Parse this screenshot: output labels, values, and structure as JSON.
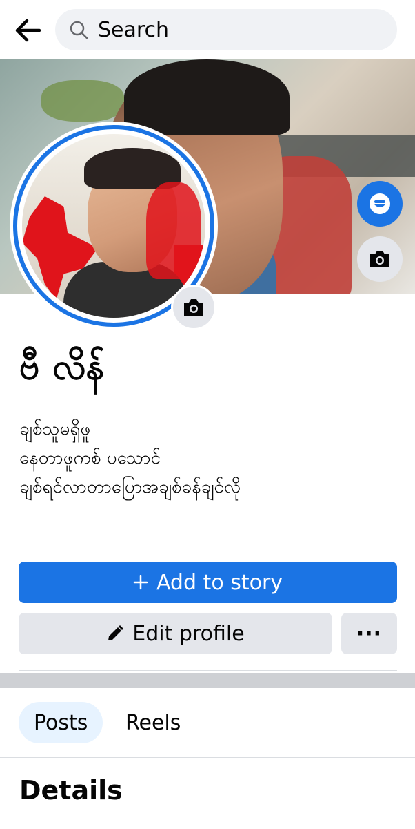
{
  "topbar": {
    "back_icon": "arrow-left-icon",
    "search_placeholder": "Search",
    "search_icon": "search-icon"
  },
  "cover": {
    "avatar_shortcut_icon": "messenger-avatar-icon",
    "camera_icon": "camera-icon"
  },
  "profile": {
    "name": "ဗီ လိန်",
    "bio_lines": [
      "ချစ်သူမရှိဖူ",
      "နေတာဖူကစ် ပသောင်",
      "ချစ်ရင်လာတာပြောအချစ်ခန်ချင်လို"
    ]
  },
  "actions": {
    "add_story_label": "Add to story",
    "edit_profile_label": "Edit profile",
    "more_label": "···"
  },
  "tabs": [
    {
      "label": "Posts",
      "active": true
    },
    {
      "label": "Reels",
      "active": false
    }
  ],
  "details": {
    "title": "Details"
  },
  "colors": {
    "accent": "#1b74e4",
    "button_gray": "#e4e6eb",
    "active_tab_bg": "#e7f3ff",
    "search_bg": "#f0f2f5"
  }
}
